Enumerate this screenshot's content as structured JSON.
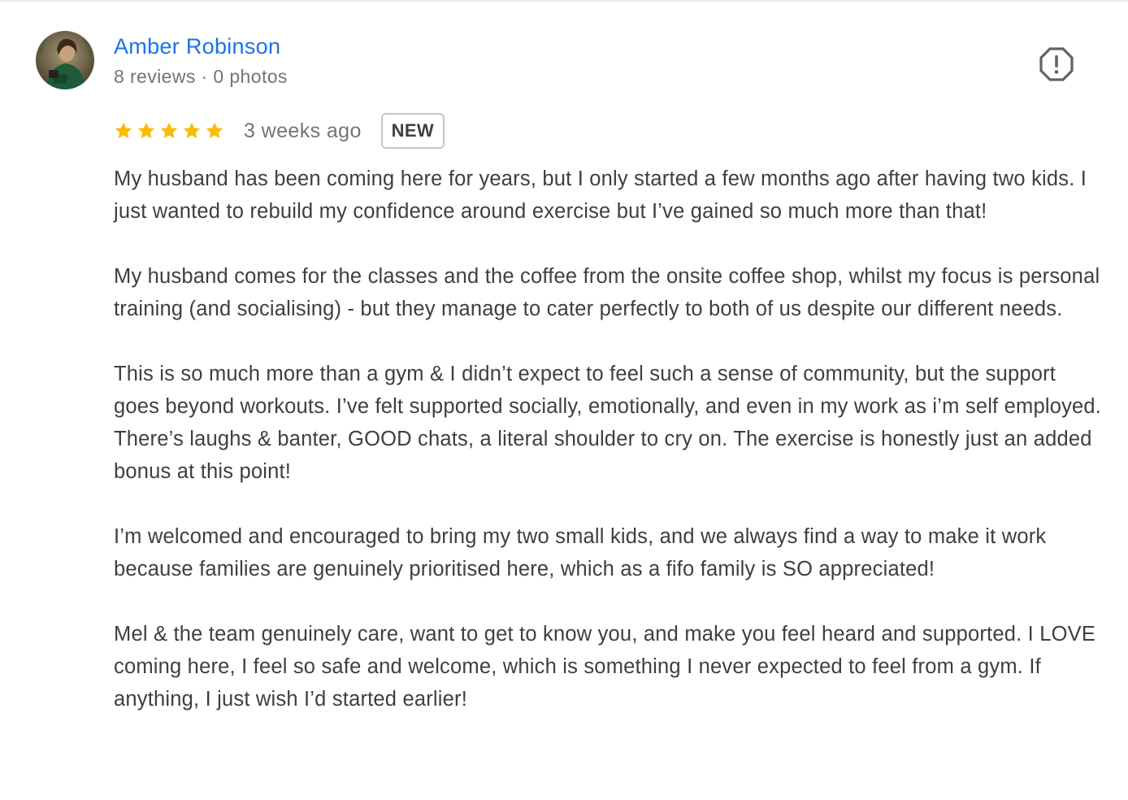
{
  "reviewer": {
    "name": "Amber Robinson",
    "meta": "8 reviews · 0 photos"
  },
  "rating": {
    "stars": 5,
    "max_stars": 5,
    "time_ago": "3 weeks ago",
    "badge": "NEW"
  },
  "icons": {
    "avatar": "avatar-photo",
    "report": "report-flag-icon",
    "star": "star-icon"
  },
  "colors": {
    "name": "#1a73e8",
    "star": "#fbbc04",
    "meta": "#70757a",
    "text": "#3c4043"
  },
  "review": {
    "paragraphs": [
      "My husband has been coming here for years, but I only started a few months ago after having two kids. I just wanted to rebuild my confidence around exercise but I’ve gained so much more than that!",
      "My husband comes for the classes and the coffee from the onsite coffee shop, whilst my focus is personal training (and socialising) - but they manage to cater perfectly to both of us despite our different needs.",
      "This is so much more than a gym & I didn’t expect to feel such a sense of community, but the support goes beyond workouts. I’ve felt supported socially, emotionally, and even in my work as i’m self employed. There’s laughs & banter, GOOD chats, a literal shoulder to cry on. The exercise is honestly just an added bonus at this point!",
      "I’m welcomed and encouraged to bring my two small kids, and we always find a way to make it work because families are genuinely prioritised here, which as a fifo family is SO appreciated!",
      "Mel & the team genuinely care, want to get to know you, and make you feel heard and supported. I LOVE coming here, I feel so safe and welcome, which is something I never expected to feel from a gym. If anything, I just wish I’d started earlier!"
    ]
  }
}
